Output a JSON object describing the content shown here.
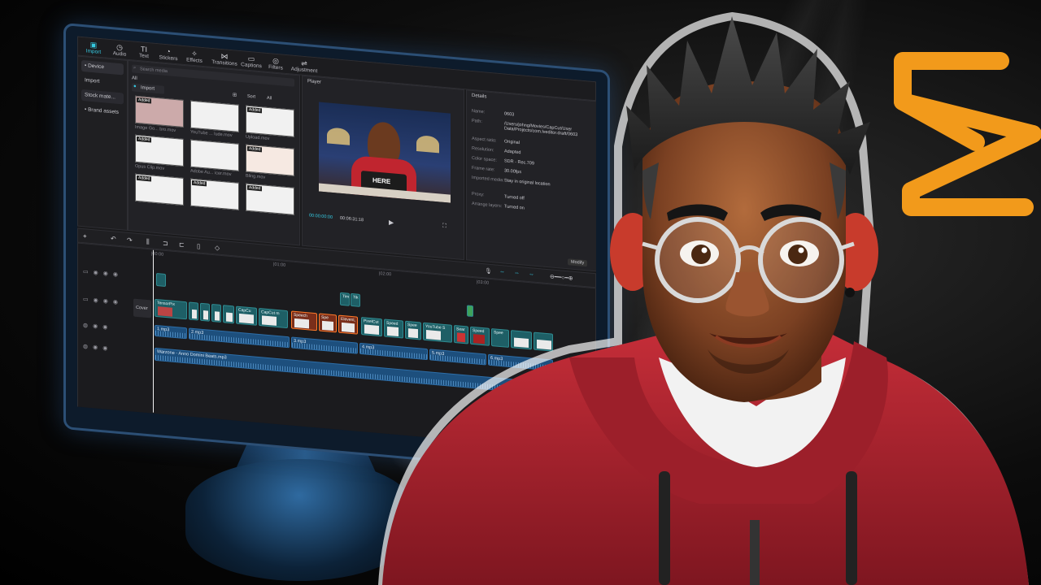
{
  "toolbar": {
    "items": [
      {
        "label": "Import",
        "icon": "import-icon"
      },
      {
        "label": "Audio",
        "icon": "audio-icon"
      },
      {
        "label": "Text",
        "icon": "text-icon"
      },
      {
        "label": "Stickers",
        "icon": "stickers-icon"
      },
      {
        "label": "Effects",
        "icon": "effects-icon"
      },
      {
        "label": "Transitions",
        "icon": "transitions-icon"
      },
      {
        "label": "Captions",
        "icon": "captions-icon"
      },
      {
        "label": "Filters",
        "icon": "filters-icon"
      },
      {
        "label": "Adjustment",
        "icon": "adjustment-icon"
      }
    ]
  },
  "left_nav": {
    "items": [
      "• Device",
      "Import",
      "Stock mate...",
      "• Brand assets"
    ]
  },
  "media": {
    "search_placeholder": "Search media",
    "import_label": "Import",
    "all_label": "All",
    "sort_label": "Sort",
    "filter_all_label": "All",
    "added_badge": "Added",
    "thumbs": [
      {
        "label": "Image Go... bro.mov"
      },
      {
        "label": "YouTube ... lude.mov"
      },
      {
        "label": "Upload.mov"
      },
      {
        "label": "Opus Clip.mov"
      },
      {
        "label": "Adobe Au... icer.mov"
      },
      {
        "label": "Bling.mov"
      },
      {
        "label": ""
      },
      {
        "label": ""
      },
      {
        "label": ""
      }
    ]
  },
  "player": {
    "title": "Player",
    "file_name": "0603",
    "current_time": "00:00:00:00",
    "total_time": "00:06:31:18",
    "laptop_text": "HERE"
  },
  "details": {
    "title": "Details",
    "shortcuts_label": "Shortcuts",
    "export_label": "Export",
    "rows": [
      {
        "key": "Name:",
        "value": "0603"
      },
      {
        "key": "Path:",
        "value": "/Users/johng/Movies/CapCut/User Data/Projects/com.lveditor.draft/0603"
      },
      {
        "key": "Aspect ratio:",
        "value": "Original"
      },
      {
        "key": "Resolution:",
        "value": "Adapted"
      },
      {
        "key": "Color space:",
        "value": "SDR - Rec.709"
      },
      {
        "key": "Frame rate:",
        "value": "30.00fps"
      },
      {
        "key": "Imported media:",
        "value": "Stay in original location"
      },
      {
        "key": "Proxy:",
        "value": "Turned off"
      },
      {
        "key": "Arrange layers:",
        "value": "Turned on"
      }
    ],
    "modify_label": "Modify"
  },
  "timeline": {
    "ruler": [
      "|00:00",
      "|01:00",
      "|02:00",
      "|03:00"
    ],
    "cover_label": "Cover",
    "video_clips": [
      "TensorPix",
      "",
      "",
      "CapCu",
      "CapCut m",
      "Speech",
      "Spe",
      "ElevenL",
      "PixelCut",
      "Speed",
      "Spee",
      "YouTube S",
      "Sear",
      "Speed",
      "Spee",
      "",
      ""
    ],
    "overlay_clips": [
      "Tim",
      "Tik"
    ],
    "audio_clips": [
      "1.mp3",
      "2.mp3",
      "3.mp3",
      "4.mp3",
      "5.mp3",
      "6.mp3"
    ],
    "music": "Warzone - Anno Domini Beats.mp3"
  },
  "colors": {
    "accent": "#35c8e0",
    "clip": "#1e5f66",
    "audio": "#1d4f7d",
    "selected_clip_border": "#ff7a2a",
    "logo": "#f29a1b",
    "hoodie": "#b2242f"
  }
}
